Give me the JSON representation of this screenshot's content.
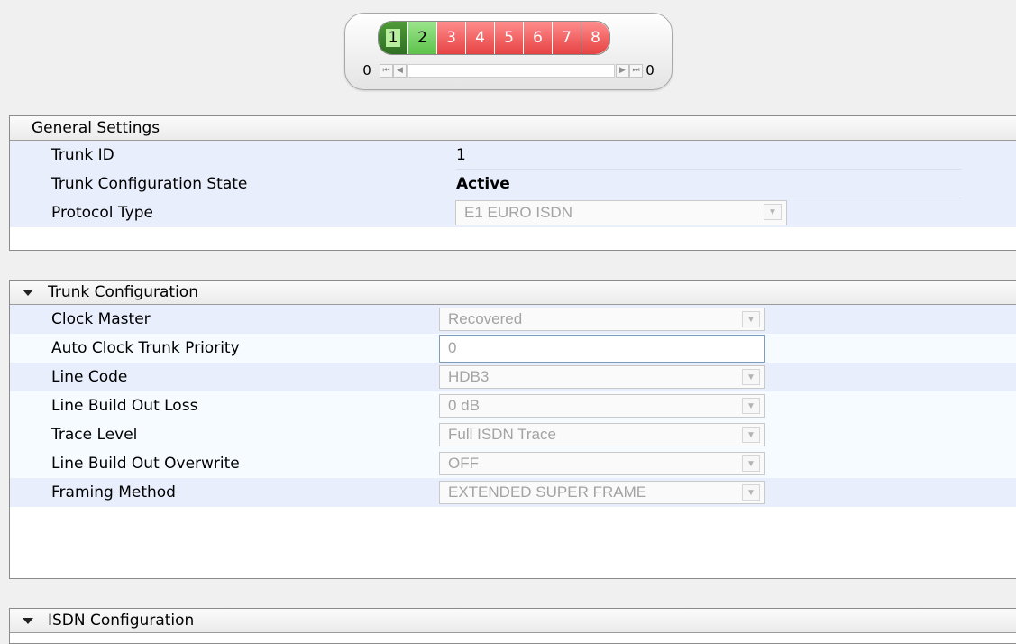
{
  "trunk_selector": {
    "trunks": [
      {
        "label": "1",
        "status": "green-selected"
      },
      {
        "label": "2",
        "status": "green"
      },
      {
        "label": "3",
        "status": "red"
      },
      {
        "label": "4",
        "status": "red"
      },
      {
        "label": "5",
        "status": "red"
      },
      {
        "label": "6",
        "status": "red"
      },
      {
        "label": "7",
        "status": "red"
      },
      {
        "label": "8",
        "status": "red"
      }
    ],
    "left_count": "0",
    "right_count": "0",
    "colors": {
      "active": "#5dc24a",
      "inactive": "#e64343"
    }
  },
  "general": {
    "title": "General Settings",
    "trunk_id_label": "Trunk ID",
    "trunk_id_value": "1",
    "state_label": "Trunk Configuration State",
    "state_value": "Active",
    "protocol_label": "Protocol Type",
    "protocol_value": "E1 EURO ISDN"
  },
  "trunk_config": {
    "title": "Trunk Configuration",
    "clock_master_label": "Clock Master",
    "clock_master_value": "Recovered",
    "auto_clock_label": "Auto Clock Trunk Priority",
    "auto_clock_value": "0",
    "line_code_label": "Line Code",
    "line_code_value": "HDB3",
    "lbo_loss_label": "Line Build Out Loss",
    "lbo_loss_value": "0 dB",
    "trace_label": "Trace Level",
    "trace_value": "Full ISDN Trace",
    "lbo_overwrite_label": "Line Build Out Overwrite",
    "lbo_overwrite_value": "OFF",
    "framing_label": "Framing Method",
    "framing_value": "EXTENDED SUPER FRAME"
  },
  "isdn_config": {
    "title": "ISDN Configuration"
  }
}
